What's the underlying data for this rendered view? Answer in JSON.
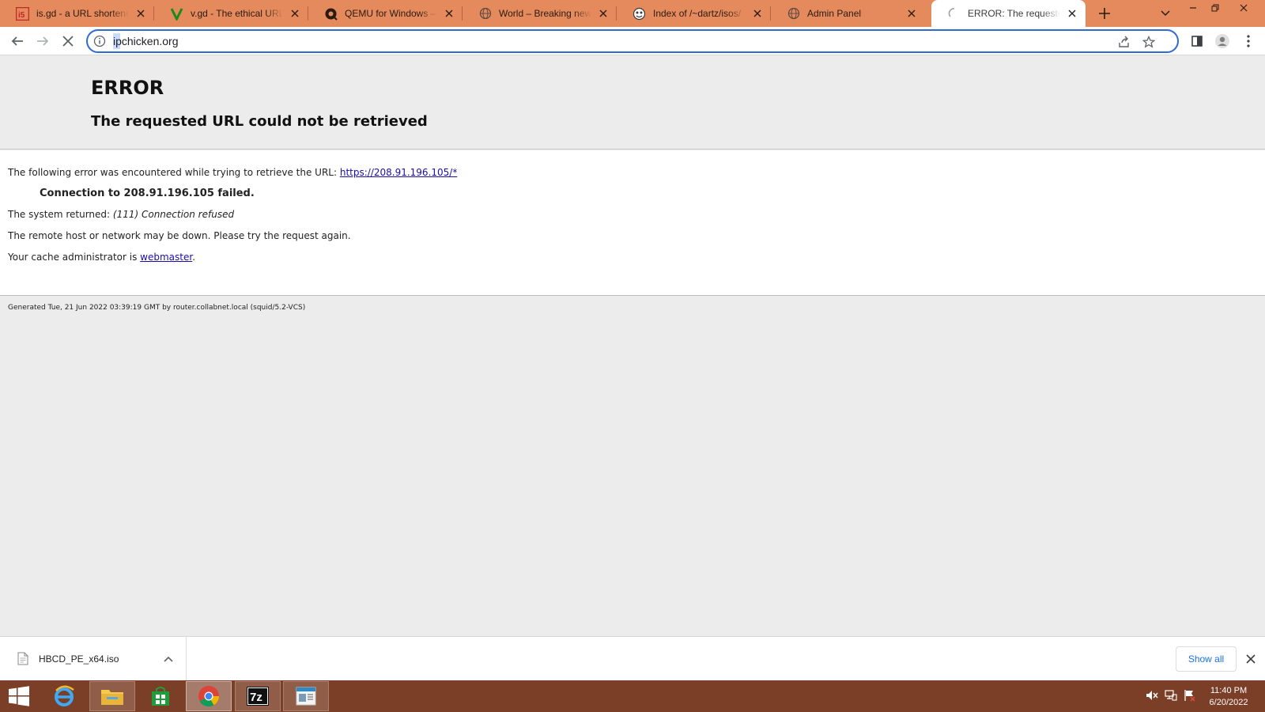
{
  "browser": {
    "tabs": [
      {
        "title": "is.gd - a URL shortener. Ma",
        "favicon": "isgd-favicon-icon"
      },
      {
        "title": "v.gd - The ethical URL short",
        "favicon": "vgd-favicon-icon"
      },
      {
        "title": "QEMU for Windows – Insta",
        "favicon": "qemu-favicon-icon"
      },
      {
        "title": "World – Breaking news",
        "favicon": "globe-icon"
      },
      {
        "title": "Index of /~dartz/isos/",
        "favicon": "directory-favicon-icon"
      },
      {
        "title": "Admin Panel",
        "favicon": "globe-icon"
      },
      {
        "title": "ERROR: The requested URL",
        "favicon": "loading-spinner-icon"
      }
    ],
    "active_tab_index": 6,
    "address": "ipchicken.org",
    "accent": "#e58a5c"
  },
  "page": {
    "heading": "ERROR",
    "subheading": "The requested URL could not be retrieved",
    "line1_prefix": "The following error was encountered while trying to retrieve the URL: ",
    "line1_link": "https://208.91.196.105/*",
    "connection_failed": "Connection to 208.91.196.105 failed.",
    "system_returned_prefix": "The system returned: ",
    "system_returned_value": "(111) Connection refused",
    "remote_host": "The remote host or network may be down. Please try the request again.",
    "cache_admin_prefix": "Your cache administrator is ",
    "cache_admin_link": "webmaster",
    "cache_admin_suffix": ".",
    "generated": "Generated Tue, 21 Jun 2022 03:39:19 GMT by router.collabnet.local (squid/5.2-VCS)"
  },
  "downloads": {
    "file_name": "HBCD_PE_x64.iso",
    "show_all": "Show all"
  },
  "taskbar": {
    "time": "11:40 PM",
    "date": "6/20/2022",
    "color": "#7b3e27"
  }
}
